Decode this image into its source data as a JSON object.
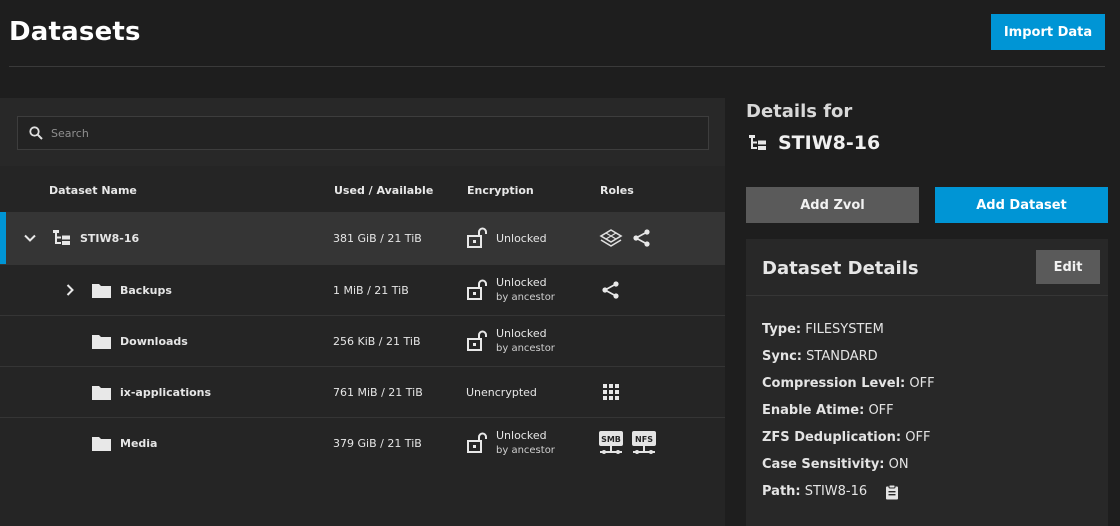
{
  "header": {
    "title": "Datasets",
    "import_label": "Import Data"
  },
  "search": {
    "placeholder": "Search"
  },
  "table": {
    "columns": [
      "Dataset Name",
      "Used / Available",
      "Encryption",
      "Roles"
    ],
    "rows": [
      {
        "name": "STIW8-16",
        "used": "381 GiB / 21 TiB",
        "encryption": "Unlocked",
        "encryption_sub": "",
        "expand": "chevron-down-icon",
        "icon": "pool-tree-icon",
        "roles": [
          "apps-layers-icon",
          "share-icon"
        ]
      },
      {
        "name": "Backups",
        "used": "1 MiB / 21 TiB",
        "encryption": "Unlocked",
        "encryption_sub": "by ancestor",
        "expand": "chevron-right-icon",
        "icon": "folder-icon",
        "roles": [
          "share-icon"
        ]
      },
      {
        "name": "Downloads",
        "used": "256 KiB / 21 TiB",
        "encryption": "Unlocked",
        "encryption_sub": "by ancestor",
        "expand": "",
        "icon": "folder-icon",
        "roles": []
      },
      {
        "name": "ix-applications",
        "used": "761 MiB / 21 TiB",
        "encryption": "Unencrypted",
        "encryption_sub": "",
        "expand": "",
        "icon": "folder-icon",
        "roles": [
          "apps-grid-icon"
        ]
      },
      {
        "name": "Media",
        "used": "379 GiB / 21 TiB",
        "encryption": "Unlocked",
        "encryption_sub": "by ancestor",
        "expand": "",
        "icon": "folder-icon",
        "roles": [
          "smb-share-icon",
          "nfs-share-icon"
        ]
      }
    ]
  },
  "role_labels": {
    "smb": "SMB",
    "nfs": "NFS"
  },
  "details": {
    "heading": "Details for",
    "dataset_name": "STIW8-16",
    "add_zvol_label": "Add Zvol",
    "add_dataset_label": "Add Dataset",
    "card_title": "Dataset Details",
    "edit_label": "Edit",
    "fields": [
      {
        "label": "Type:",
        "value": "FILESYSTEM"
      },
      {
        "label": "Sync:",
        "value": "STANDARD"
      },
      {
        "label": "Compression Level:",
        "value": "OFF"
      },
      {
        "label": "Enable Atime:",
        "value": "OFF"
      },
      {
        "label": "ZFS Deduplication:",
        "value": "OFF"
      },
      {
        "label": "Case Sensitivity:",
        "value": "ON"
      },
      {
        "label": "Path:",
        "value": "STIW8-16"
      }
    ]
  },
  "colors": {
    "accent": "#0095d5",
    "background": "#1e1e1e",
    "panel": "#252525",
    "selected_row": "#353535"
  }
}
